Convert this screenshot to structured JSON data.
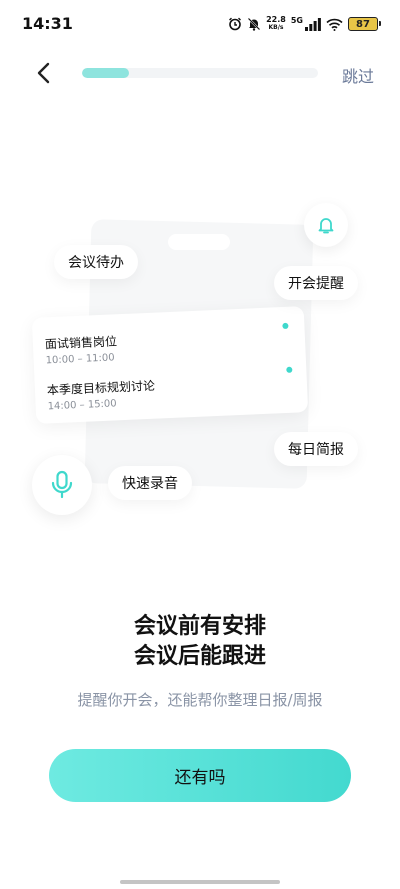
{
  "status_bar": {
    "time": "14:31",
    "net_speed_value": "22.8",
    "net_speed_unit": "KB/s",
    "network": "5G",
    "battery": "87",
    "icons": [
      "alarm-icon",
      "mute-bell-icon",
      "signal-icon",
      "wifi-icon",
      "battery-icon"
    ]
  },
  "header": {
    "back_icon": "chevron-left-icon",
    "progress": 0.2,
    "skip_label": "跳过"
  },
  "illustration": {
    "tags": {
      "meeting_todo": "会议待办",
      "meeting_reminder": "开会提醒",
      "daily_brief": "每日简报",
      "quick_record": "快速录音"
    },
    "meetings": [
      {
        "title": "面试销售岗位",
        "time": "10:00 – 11:00"
      },
      {
        "title": "本季度目标规划讨论",
        "time": "14:00 – 15:00"
      }
    ],
    "bell_icon": "bell-icon",
    "mic_icon": "microphone-icon",
    "accent_color": "#3fd8cc"
  },
  "main": {
    "headline_line1": "会议前有安排",
    "headline_line2": "会议后能跟进",
    "subtitle": "提醒你开会，还能帮你整理日报/周报",
    "button_label": "还有吗",
    "button_color": "#4fdfd5"
  }
}
